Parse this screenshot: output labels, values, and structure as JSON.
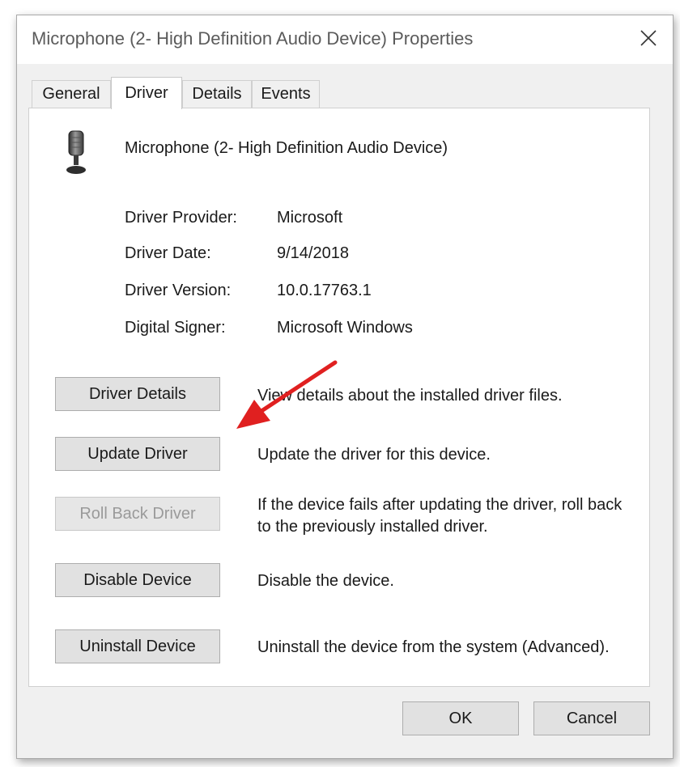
{
  "window": {
    "title": "Microphone (2- High Definition Audio Device) Properties",
    "close_icon": "close-icon"
  },
  "tabs": [
    {
      "label": "General",
      "active": false
    },
    {
      "label": "Driver",
      "active": true
    },
    {
      "label": "Details",
      "active": false
    },
    {
      "label": "Events",
      "active": false
    }
  ],
  "device": {
    "name": "Microphone (2- High Definition Audio Device)",
    "icon": "microphone-icon"
  },
  "info": [
    {
      "label": "Driver Provider:",
      "value": "Microsoft"
    },
    {
      "label": "Driver Date:",
      "value": "9/14/2018"
    },
    {
      "label": "Driver Version:",
      "value": "10.0.17763.1"
    },
    {
      "label": "Digital Signer:",
      "value": "Microsoft Windows"
    }
  ],
  "actions": [
    {
      "label": "Driver Details",
      "description": "View details about the installed driver files.",
      "enabled": true
    },
    {
      "label": "Update Driver",
      "description": "Update the driver for this device.",
      "enabled": true
    },
    {
      "label": "Roll Back Driver",
      "description": "If the device fails after updating the driver, roll back to the previously installed driver.",
      "enabled": false
    },
    {
      "label": "Disable Device",
      "description": "Disable the device.",
      "enabled": true
    },
    {
      "label": "Uninstall Device",
      "description": "Uninstall the device from the system (Advanced).",
      "enabled": true
    }
  ],
  "annotation": {
    "icon": "red-arrow-icon",
    "color": "#e02020"
  },
  "footer": {
    "ok_label": "OK",
    "cancel_label": "Cancel"
  }
}
